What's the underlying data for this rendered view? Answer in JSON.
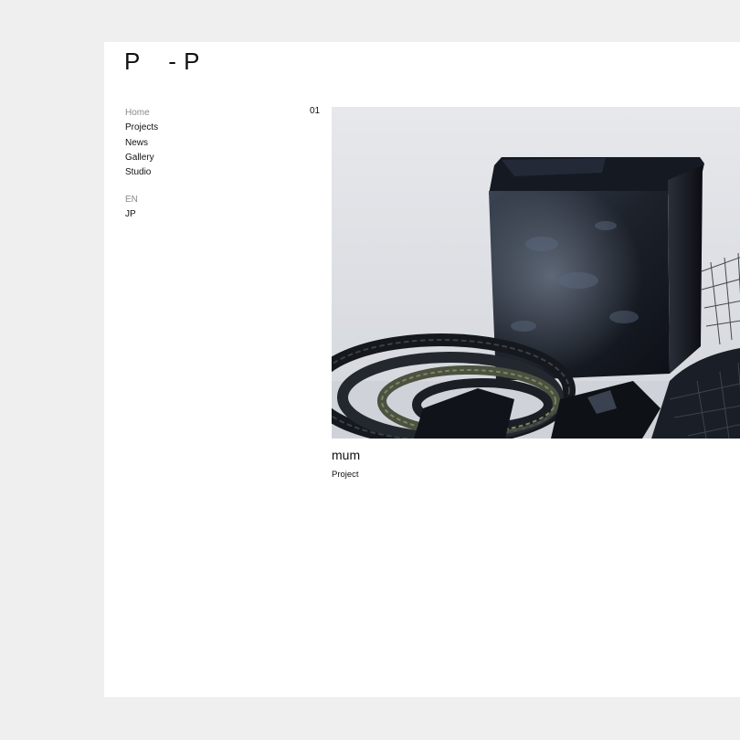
{
  "header": {
    "logo_text": "P    - P"
  },
  "nav": {
    "items": [
      {
        "label": "Home",
        "active": true
      },
      {
        "label": "Projects",
        "active": false
      },
      {
        "label": "News",
        "active": false
      },
      {
        "label": "Gallery",
        "active": false
      },
      {
        "label": "Studio",
        "active": false
      }
    ]
  },
  "lang": {
    "items": [
      {
        "label": "EN",
        "active": true
      },
      {
        "label": "JP",
        "active": false
      }
    ]
  },
  "featured": {
    "index": "01",
    "title": "mum",
    "category": "Project",
    "image_alt": "dark sculptural objects: textured black box, braided rope coils, netting"
  },
  "colors": {
    "background": "#efefef",
    "panel": "#ffffff",
    "text": "#111111",
    "muted": "#8a8a8a"
  }
}
